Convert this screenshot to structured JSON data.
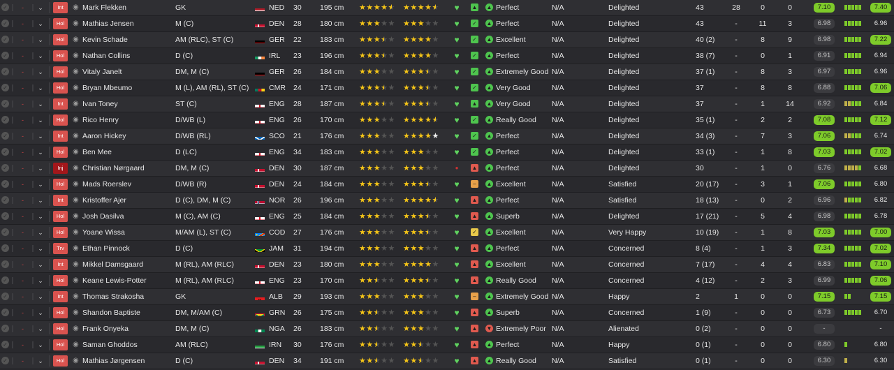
{
  "colors": {
    "accent_green": "#7ecb2a",
    "status_red": "#d9534f",
    "injury_red": "#a3171b",
    "star_gold": "#f5c518"
  },
  "rows": [
    {
      "status": "Int",
      "name": "Mark Flekken",
      "pos": "GK",
      "flag": "NED",
      "nat": "NED",
      "age": "30",
      "height": "195 cm",
      "ca": [
        1,
        1,
        1,
        1,
        0.5
      ],
      "pa": [
        1,
        1,
        1,
        1,
        0.5
      ],
      "heart": "heart",
      "mood": "up",
      "cond_icon": "up",
      "cond": "Perfect",
      "na": "N/A",
      "happy": "Delighted",
      "apps": "43",
      "goals": "28",
      "ast": "0",
      "pom": "0",
      "avg": "7.10",
      "avg_hi": true,
      "form": [
        "g",
        "g",
        "g",
        "g",
        "g"
      ],
      "rating": "7.40",
      "rating_hi": true
    },
    {
      "status": "Hol",
      "name": "Mathias Jensen",
      "pos": "M (C)",
      "flag": "DEN",
      "nat": "DEN",
      "age": "28",
      "height": "180 cm",
      "ca": [
        1,
        1,
        1,
        0,
        0
      ],
      "pa": [
        1,
        1,
        1,
        0,
        0
      ],
      "heart": "heart",
      "mood": "check",
      "cond_icon": "up",
      "cond": "Perfect",
      "na": "N/A",
      "happy": "Delighted",
      "apps": "43",
      "goals": "-",
      "ast": "11",
      "pom": "3",
      "avg": "6.98",
      "avg_hi": false,
      "form": [
        "g",
        "g",
        "g",
        "g",
        "g"
      ],
      "rating": "6.96",
      "rating_hi": false
    },
    {
      "status": "Hol",
      "name": "Kevin Schade",
      "pos": "AM (RLC), ST (C)",
      "flag": "GER",
      "nat": "GER",
      "age": "22",
      "height": "183 cm",
      "ca": [
        1,
        1,
        1,
        0.5,
        0
      ],
      "pa": [
        1,
        1,
        1,
        1,
        0
      ],
      "heart": "heart",
      "mood": "check",
      "cond_icon": "up",
      "cond": "Excellent",
      "na": "N/A",
      "happy": "Delighted",
      "apps": "40 (2)",
      "goals": "-",
      "ast": "8",
      "pom": "9",
      "avg": "6.98",
      "avg_hi": false,
      "form": [
        "g",
        "g",
        "g",
        "g",
        "g"
      ],
      "rating": "7.22",
      "rating_hi": true
    },
    {
      "status": "Hol",
      "name": "Nathan Collins",
      "pos": "D (C)",
      "flag": "IRL",
      "nat": "IRL",
      "age": "23",
      "height": "196 cm",
      "ca": [
        1,
        1,
        1,
        0.5,
        0
      ],
      "pa": [
        1,
        1,
        1,
        1,
        0
      ],
      "heart": "heart",
      "mood": "check",
      "cond_icon": "up",
      "cond": "Perfect",
      "na": "N/A",
      "happy": "Delighted",
      "apps": "38 (7)",
      "goals": "-",
      "ast": "0",
      "pom": "1",
      "avg": "6.91",
      "avg_hi": false,
      "form": [
        "g",
        "g",
        "g",
        "g",
        "g"
      ],
      "rating": "6.94",
      "rating_hi": false
    },
    {
      "status": "Hol",
      "name": "Vitaly Janelt",
      "pos": "DM, M (C)",
      "flag": "GER",
      "nat": "GER",
      "age": "26",
      "height": "184 cm",
      "ca": [
        1,
        1,
        1,
        0,
        0
      ],
      "pa": [
        1,
        1,
        1,
        0.5,
        0
      ],
      "heart": "heart",
      "mood": "check",
      "cond_icon": "up",
      "cond": "Extremely Good",
      "na": "N/A",
      "happy": "Delighted",
      "apps": "37 (1)",
      "goals": "-",
      "ast": "8",
      "pom": "3",
      "avg": "6.97",
      "avg_hi": false,
      "form": [
        "g",
        "g",
        "g",
        "g",
        "g"
      ],
      "rating": "6.96",
      "rating_hi": false
    },
    {
      "status": "Hol",
      "name": "Bryan Mbeumo",
      "pos": "M (L), AM (RL), ST (C)",
      "flag": "CMR",
      "nat": "CMR",
      "age": "24",
      "height": "171 cm",
      "ca": [
        1,
        1,
        1,
        0.5,
        0
      ],
      "pa": [
        1,
        1,
        1,
        0.5,
        0
      ],
      "heart": "heart",
      "mood": "check",
      "cond_icon": "up",
      "cond": "Very Good",
      "na": "N/A",
      "happy": "Delighted",
      "apps": "37",
      "goals": "-",
      "ast": "8",
      "pom": "8",
      "avg": "6.88",
      "avg_hi": false,
      "form": [
        "g",
        "g",
        "g",
        "g",
        "g"
      ],
      "rating": "7.06",
      "rating_hi": true
    },
    {
      "status": "Int",
      "name": "Ivan Toney",
      "pos": "ST (C)",
      "flag": "ENG",
      "nat": "ENG",
      "age": "28",
      "height": "187 cm",
      "ca": [
        1,
        1,
        1,
        0.5,
        0
      ],
      "pa": [
        1,
        1,
        1,
        0.5,
        0
      ],
      "heart": "heart",
      "mood": "up",
      "cond_icon": "up",
      "cond": "Very Good",
      "na": "N/A",
      "happy": "Delighted",
      "apps": "37",
      "goals": "-",
      "ast": "1",
      "pom": "14",
      "avg": "6.92",
      "avg_hi": false,
      "form": [
        "o",
        "o",
        "g",
        "g",
        "g"
      ],
      "rating": "6.84",
      "rating_hi": false
    },
    {
      "status": "Hol",
      "name": "Rico Henry",
      "pos": "D/WB (L)",
      "flag": "ENG",
      "nat": "ENG",
      "age": "26",
      "height": "170 cm",
      "ca": [
        1,
        1,
        1,
        0,
        0
      ],
      "pa": [
        1,
        1,
        1,
        1,
        0.5
      ],
      "heart": "heart",
      "mood": "check",
      "cond_icon": "up",
      "cond": "Really Good",
      "na": "N/A",
      "happy": "Delighted",
      "apps": "35 (1)",
      "goals": "-",
      "ast": "2",
      "pom": "2",
      "avg": "7.08",
      "avg_hi": true,
      "form": [
        "g",
        "g",
        "g",
        "g",
        "g"
      ],
      "rating": "7.12",
      "rating_hi": true
    },
    {
      "status": "Int",
      "name": "Aaron Hickey",
      "pos": "D/WB (RL)",
      "flag": "SCO",
      "nat": "SCO",
      "age": "21",
      "height": "176 cm",
      "ca": [
        1,
        1,
        1,
        0,
        0
      ],
      "pa": [
        1,
        1,
        1,
        1,
        "w"
      ],
      "heart": "heart",
      "mood": "check",
      "cond_icon": "up",
      "cond": "Perfect",
      "na": "N/A",
      "happy": "Delighted",
      "apps": "34 (3)",
      "goals": "-",
      "ast": "7",
      "pom": "3",
      "avg": "7.06",
      "avg_hi": true,
      "form": [
        "o",
        "o",
        "g",
        "g",
        "g"
      ],
      "rating": "6.74",
      "rating_hi": false
    },
    {
      "status": "Hol",
      "name": "Ben Mee",
      "pos": "D (LC)",
      "flag": "ENG",
      "nat": "ENG",
      "age": "34",
      "height": "183 cm",
      "ca": [
        1,
        1,
        1,
        0,
        0
      ],
      "pa": [
        1,
        1,
        1,
        0,
        0
      ],
      "heart": "heart",
      "mood": "check",
      "cond_icon": "up",
      "cond": "Perfect",
      "na": "N/A",
      "happy": "Delighted",
      "apps": "33 (1)",
      "goals": "-",
      "ast": "1",
      "pom": "8",
      "avg": "7.03",
      "avg_hi": true,
      "form": [
        "g",
        "g",
        "g",
        "g",
        "g"
      ],
      "rating": "7.02",
      "rating_hi": true
    },
    {
      "status": "Inj",
      "name": "Christian Nørgaard",
      "pos": "DM, M (C)",
      "flag": "DEN",
      "nat": "DEN",
      "age": "30",
      "height": "187 cm",
      "ca": [
        1,
        1,
        1,
        0,
        0
      ],
      "pa": [
        1,
        1,
        1,
        0,
        0
      ],
      "heart": "injury",
      "mood": "red",
      "cond_icon": "up",
      "cond": "Perfect",
      "na": "N/A",
      "happy": "Delighted",
      "apps": "30",
      "goals": "-",
      "ast": "1",
      "pom": "0",
      "avg": "6.76",
      "avg_hi": false,
      "form": [
        "o",
        "o",
        "o",
        "o",
        "g"
      ],
      "rating": "6.68",
      "rating_hi": false
    },
    {
      "status": "Hol",
      "name": "Mads Roerslev",
      "pos": "D/WB (R)",
      "flag": "DEN",
      "nat": "DEN",
      "age": "24",
      "height": "184 cm",
      "ca": [
        1,
        1,
        1,
        0,
        0
      ],
      "pa": [
        1,
        1,
        1,
        0.5,
        0
      ],
      "heart": "heart",
      "mood": "orange",
      "cond_icon": "up",
      "cond": "Excellent",
      "na": "N/A",
      "happy": "Satisfied",
      "apps": "20 (17)",
      "goals": "-",
      "ast": "3",
      "pom": "1",
      "avg": "7.06",
      "avg_hi": true,
      "form": [
        "g",
        "g",
        "g",
        "g",
        "g"
      ],
      "rating": "6.80",
      "rating_hi": false
    },
    {
      "status": "Int",
      "name": "Kristoffer Ajer",
      "pos": "D (C), DM, M (C)",
      "flag": "NOR",
      "nat": "NOR",
      "age": "26",
      "height": "196 cm",
      "ca": [
        1,
        1,
        1,
        0,
        0
      ],
      "pa": [
        1,
        1,
        1,
        1,
        0.5
      ],
      "heart": "heart",
      "mood": "red",
      "cond_icon": "up",
      "cond": "Perfect",
      "na": "N/A",
      "happy": "Satisfied",
      "apps": "18 (13)",
      "goals": "-",
      "ast": "0",
      "pom": "2",
      "avg": "6.96",
      "avg_hi": false,
      "form": [
        "o",
        "g",
        "g",
        "g",
        "g"
      ],
      "rating": "6.82",
      "rating_hi": false
    },
    {
      "status": "Hol",
      "name": "Josh Dasilva",
      "pos": "M (C), AM (C)",
      "flag": "ENG",
      "nat": "ENG",
      "age": "25",
      "height": "184 cm",
      "ca": [
        1,
        1,
        1,
        0,
        0
      ],
      "pa": [
        1,
        1,
        1,
        0.5,
        0
      ],
      "heart": "heart",
      "mood": "red",
      "cond_icon": "up",
      "cond": "Superb",
      "na": "N/A",
      "happy": "Delighted",
      "apps": "17 (21)",
      "goals": "-",
      "ast": "5",
      "pom": "4",
      "avg": "6.98",
      "avg_hi": false,
      "form": [
        "g",
        "g",
        "g",
        "g",
        "g"
      ],
      "rating": "6.78",
      "rating_hi": false
    },
    {
      "status": "Hol",
      "name": "Yoane Wissa",
      "pos": "M/AM (L), ST (C)",
      "flag": "COD",
      "nat": "COD",
      "age": "27",
      "height": "176 cm",
      "ca": [
        1,
        1,
        1,
        0,
        0
      ],
      "pa": [
        1,
        1,
        1,
        0.5,
        0
      ],
      "heart": "heart",
      "mood": "yellow",
      "cond_icon": "up",
      "cond": "Excellent",
      "na": "N/A",
      "happy": "Very Happy",
      "apps": "10 (19)",
      "goals": "-",
      "ast": "1",
      "pom": "8",
      "avg": "7.03",
      "avg_hi": true,
      "form": [
        "g",
        "g",
        "g",
        "g",
        "g"
      ],
      "rating": "7.00",
      "rating_hi": true
    },
    {
      "status": "Trv",
      "name": "Ethan Pinnock",
      "pos": "D (C)",
      "flag": "JAM",
      "nat": "JAM",
      "age": "31",
      "height": "194 cm",
      "ca": [
        1,
        1,
        1,
        0,
        0
      ],
      "pa": [
        1,
        1,
        1,
        0,
        0
      ],
      "heart": "heart",
      "mood": "red",
      "cond_icon": "up",
      "cond": "Perfect",
      "na": "N/A",
      "happy": "Concerned",
      "apps": "8 (4)",
      "goals": "-",
      "ast": "1",
      "pom": "3",
      "avg": "7.34",
      "avg_hi": true,
      "form": [
        "g",
        "g",
        "g",
        "g",
        "g"
      ],
      "rating": "7.02",
      "rating_hi": true
    },
    {
      "status": "Int",
      "name": "Mikkel Damsgaard",
      "pos": "M (RL), AM (RLC)",
      "flag": "DEN",
      "nat": "DEN",
      "age": "23",
      "height": "180 cm",
      "ca": [
        1,
        1,
        1,
        0,
        0
      ],
      "pa": [
        1,
        1,
        1,
        1,
        0
      ],
      "heart": "heart",
      "mood": "red",
      "cond_icon": "up",
      "cond": "Excellent",
      "na": "N/A",
      "happy": "Concerned",
      "apps": "7 (17)",
      "goals": "-",
      "ast": "4",
      "pom": "4",
      "avg": "6.83",
      "avg_hi": false,
      "form": [
        "g",
        "g",
        "g",
        "g",
        "g"
      ],
      "rating": "7.10",
      "rating_hi": true
    },
    {
      "status": "Hol",
      "name": "Keane Lewis-Potter",
      "pos": "M (RL), AM (RLC)",
      "flag": "ENG",
      "nat": "ENG",
      "age": "23",
      "height": "170 cm",
      "ca": [
        1,
        1,
        0.5,
        0,
        0
      ],
      "pa": [
        1,
        1,
        1,
        0.5,
        0
      ],
      "heart": "heart",
      "mood": "red",
      "cond_icon": "up",
      "cond": "Really Good",
      "na": "N/A",
      "happy": "Concerned",
      "apps": "4 (12)",
      "goals": "-",
      "ast": "2",
      "pom": "3",
      "avg": "6.99",
      "avg_hi": false,
      "form": [
        "g",
        "g",
        "g",
        "g",
        "g"
      ],
      "rating": "7.06",
      "rating_hi": true
    },
    {
      "status": "Int",
      "name": "Thomas Strakosha",
      "pos": "GK",
      "flag": "ALB",
      "nat": "ALB",
      "age": "29",
      "height": "193 cm",
      "ca": [
        1,
        1,
        1,
        0,
        0
      ],
      "pa": [
        1,
        1,
        1,
        0,
        0
      ],
      "heart": "heart",
      "mood": "orange",
      "cond_icon": "up",
      "cond": "Extremely Good",
      "na": "N/A",
      "happy": "Happy",
      "apps": "2",
      "goals": "1",
      "ast": "0",
      "pom": "0",
      "avg": "7.15",
      "avg_hi": true,
      "form": [
        "g",
        "g"
      ],
      "rating": "7.15",
      "rating_hi": true
    },
    {
      "status": "Hol",
      "name": "Shandon Baptiste",
      "pos": "DM, M/AM (C)",
      "flag": "GRN",
      "nat": "GRN",
      "age": "26",
      "height": "175 cm",
      "ca": [
        1,
        1,
        0.5,
        0,
        0
      ],
      "pa": [
        1,
        1,
        1,
        0,
        0
      ],
      "heart": "heart",
      "mood": "red",
      "cond_icon": "up",
      "cond": "Superb",
      "na": "N/A",
      "happy": "Concerned",
      "apps": "1 (9)",
      "goals": "-",
      "ast": "0",
      "pom": "0",
      "avg": "6.73",
      "avg_hi": false,
      "form": [
        "g",
        "g",
        "g",
        "g",
        "g"
      ],
      "rating": "6.70",
      "rating_hi": false
    },
    {
      "status": "Hol",
      "name": "Frank Onyeka",
      "pos": "DM, M (C)",
      "flag": "NGA",
      "nat": "NGA",
      "age": "26",
      "height": "183 cm",
      "ca": [
        1,
        1,
        0.5,
        0,
        0
      ],
      "pa": [
        1,
        1,
        1,
        0,
        0
      ],
      "heart": "heart",
      "mood": "red",
      "cond_icon": "down",
      "cond": "Extremely Poor",
      "na": "N/A",
      "happy": "Alienated",
      "apps": "0 (2)",
      "goals": "-",
      "ast": "0",
      "pom": "0",
      "avg": "-",
      "avg_hi": false,
      "form": [],
      "rating": "-",
      "rating_hi": false
    },
    {
      "status": "Hol",
      "name": "Saman Ghoddos",
      "pos": "AM (RLC)",
      "flag": "IRN",
      "nat": "IRN",
      "age": "30",
      "height": "176 cm",
      "ca": [
        1,
        1,
        0.5,
        0,
        0
      ],
      "pa": [
        1,
        1,
        0.5,
        0,
        0
      ],
      "heart": "heart",
      "mood": "red",
      "cond_icon": "up",
      "cond": "Perfect",
      "na": "N/A",
      "happy": "Happy",
      "apps": "0 (1)",
      "goals": "-",
      "ast": "0",
      "pom": "0",
      "avg": "6.80",
      "avg_hi": false,
      "form": [
        "g"
      ],
      "rating": "6.80",
      "rating_hi": false
    },
    {
      "status": "Hol",
      "name": "Mathias Jørgensen",
      "pos": "D (C)",
      "flag": "DEN",
      "nat": "DEN",
      "age": "34",
      "height": "191 cm",
      "ca": [
        1,
        1,
        0.5,
        0,
        0
      ],
      "pa": [
        1,
        1,
        0.5,
        0,
        0
      ],
      "heart": "heart",
      "mood": "red",
      "cond_icon": "up",
      "cond": "Really Good",
      "na": "N/A",
      "happy": "Satisfied",
      "apps": "0 (1)",
      "goals": "-",
      "ast": "0",
      "pom": "0",
      "avg": "6.30",
      "avg_hi": false,
      "form": [
        "o"
      ],
      "rating": "6.30",
      "rating_hi": false
    }
  ]
}
